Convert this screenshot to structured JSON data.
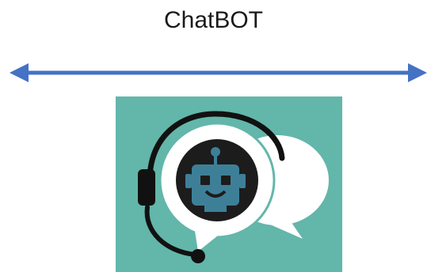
{
  "header": {
    "title": "ChatBOT"
  },
  "connector": {
    "type": "double-headed-arrow",
    "color": "#4472C4"
  },
  "logo": {
    "icon": "chatbot-headset-icon",
    "background_color": "#63B6AA",
    "bot_icon": "robot-face-icon",
    "bot_color": "#3E7F98",
    "headset_color": "#111111"
  }
}
